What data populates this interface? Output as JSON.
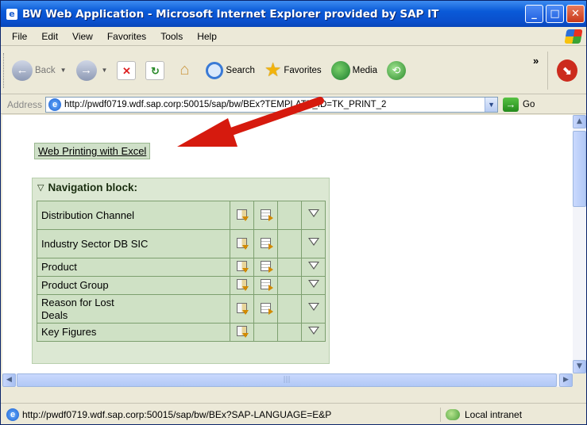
{
  "window": {
    "title": "BW Web Application - Microsoft Internet Explorer provided by SAP IT"
  },
  "menu": [
    "File",
    "Edit",
    "View",
    "Favorites",
    "Tools",
    "Help"
  ],
  "toolbar": {
    "back": "Back",
    "search": "Search",
    "favorites": "Favorites",
    "media": "Media"
  },
  "address": {
    "label": "Address",
    "url": "http://pwdf0719.wdf.sap.corp:50015/sap/bw/BEx?TEMPLATE_ID=TK_PRINT_2",
    "go": "Go"
  },
  "page": {
    "excel_link": "Web Printing with Excel",
    "nav_block": {
      "title": "Navigation block:",
      "rows": [
        {
          "label": "Distribution Channel",
          "icon1": true,
          "icon2": true,
          "filter": true
        },
        {
          "label": "Industry Sector DB SIC",
          "icon1": true,
          "icon2": true,
          "filter": true
        },
        {
          "label": "Product",
          "icon1": true,
          "icon2": true,
          "filter": true
        },
        {
          "label": "Product Group",
          "icon1": true,
          "icon2": true,
          "filter": true
        },
        {
          "label": "Reason for Lost Deals",
          "icon1": true,
          "icon2": true,
          "filter": true
        },
        {
          "label": "Key Figures",
          "icon1": true,
          "icon2": false,
          "filter": true
        }
      ]
    }
  },
  "status": {
    "text": "http://pwdf0719.wdf.sap.corp:50015/sap/bw/BEx?SAP-LANGUAGE=E&P",
    "zone": "Local intranet"
  },
  "colors": {
    "titlebar": "#0a5ad8",
    "nav_bg": "#dce8d3",
    "arrow": "#d61a0e"
  }
}
